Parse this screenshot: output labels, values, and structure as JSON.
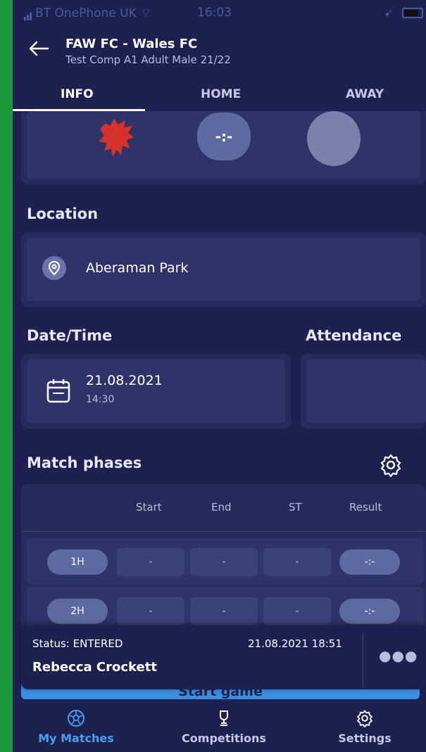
{
  "status_bar": {
    "carrier": "BT OnePhone UK",
    "time": "16:03"
  },
  "header": {
    "title": "FAW FC - Wales FC",
    "subtitle": "Test Comp A1 Adult Male 21/22",
    "tabs": [
      {
        "label": "INFO",
        "active": true
      },
      {
        "label": "HOME",
        "active": false
      },
      {
        "label": "AWAY",
        "active": false
      }
    ]
  },
  "teams": {
    "score": "-:-"
  },
  "location": {
    "title": "Location",
    "value": "Aberaman Park"
  },
  "datetime": {
    "title": "Date/Time",
    "date": "21.08.2021",
    "time": "14:30"
  },
  "attendance": {
    "title": "Attendance"
  },
  "phases": {
    "title": "Match phases",
    "columns": [
      "Start",
      "End",
      "ST",
      "Result"
    ],
    "rows": [
      {
        "phase": "1H",
        "start": "-",
        "end": "-",
        "st": "-",
        "result": "-:-"
      },
      {
        "phase": "2H",
        "start": "-",
        "end": "-",
        "st": "-",
        "result": "-:-"
      }
    ]
  },
  "status": {
    "label": "Status: ENTERED",
    "datetime": "21.08.2021 18:51",
    "user": "Rebecca Crockett",
    "start_label": "Start game"
  },
  "nav": {
    "items": [
      {
        "label": "My Matches",
        "icon": "football-icon",
        "active": true
      },
      {
        "label": "Competitions",
        "icon": "trophy-icon",
        "active": false
      },
      {
        "label": "Settings",
        "icon": "gear-icon",
        "active": false
      }
    ]
  },
  "colors": {
    "background": "#1d2150",
    "card": "#262b5e",
    "accent": "#4a9ef0",
    "dragon": "#d8302a"
  }
}
